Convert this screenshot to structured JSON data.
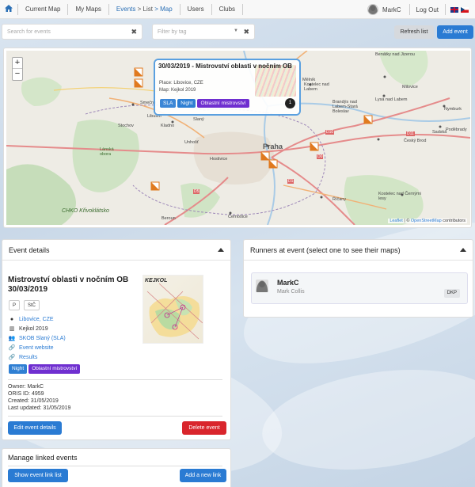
{
  "navbar": {
    "items": [
      "Current Map",
      "My Maps",
      "Events",
      "Users",
      "Clubs"
    ],
    "events_crumb": [
      "> List",
      "> Map"
    ],
    "user": "MarkC",
    "logout": "Log Out"
  },
  "filters": {
    "search_placeholder": "Search for events",
    "tag_placeholder": "Filter by tag",
    "clear": "✖",
    "refresh_label": "Refresh list",
    "add_label": "Add event"
  },
  "map": {
    "zoom_in": "+",
    "zoom_out": "−",
    "popup": {
      "title": "30/03/2019 - Mistrovství oblasti v nočním OB",
      "place": "Place: Libovice, CZE",
      "map": "Map: Kejkol 2019",
      "tags": [
        "SLA",
        "Night",
        "Oblastní mistrovství"
      ],
      "badge": "1"
    },
    "labels": [
      "Benátky nad Jizerou",
      "Mělník",
      "Kostelec nad Labem",
      "Milovice",
      "Brandýs nad Labem-Stará Boleslav",
      "Lysá nad Labem",
      "Nymburk",
      "Poděbrady",
      "Smečno",
      "Slaný",
      "Kladno",
      "Unhošť",
      "Stochov",
      "Lánská obora",
      "Praha",
      "Hostivice",
      "Beroun",
      "Kostelec nad Černými lesy",
      "Český Brod",
      "Sadská",
      "Říčany",
      "Černošice",
      "CHKO Křivoklátsko",
      "D10",
      "D11",
      "D0",
      "D1",
      "D5",
      "Libušín"
    ],
    "attribution": {
      "leaflet": "Leaflet",
      "sep": " | © ",
      "osm": "OpenStreetMap",
      "rest": " contributors"
    }
  },
  "event_details": {
    "header": "Event details",
    "title": "Mistrovství oblasti v nočním OB 30/03/2019",
    "pills": [
      "P",
      "StČ"
    ],
    "place": "Libovice, CZE",
    "map": "Kejkol 2019",
    "club": "SKOB Slaný (SLA)",
    "website": "Event website",
    "results": "Results",
    "tags": [
      "Night",
      "Oblastní mistrovství"
    ],
    "owner": "Owner: MarkC",
    "oris": "ORIS ID: 4959",
    "created": "Created: 31/05/2019",
    "updated": "Last updated: 31/05/2019",
    "edit_label": "Edit event details",
    "delete_label": "Delete event",
    "map_thumb_label": "KEJKOL"
  },
  "linked_events": {
    "header": "Manage linked events",
    "show_label": "Show event link list",
    "add_label": "Add a new link"
  },
  "runners": {
    "header": "Runners at event (select one to see their maps)",
    "runner": {
      "user": "MarkC",
      "name": "Mark Collis",
      "club": "DKP"
    }
  }
}
